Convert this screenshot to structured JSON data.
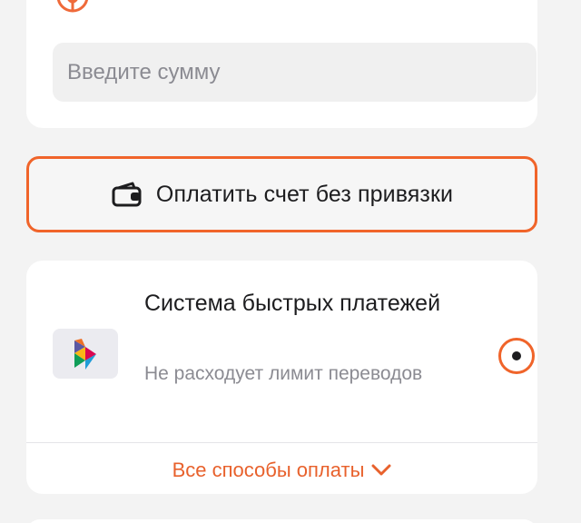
{
  "amount": {
    "placeholder": "Введите сумму",
    "value": ""
  },
  "pay_button": {
    "label": "Оплатить счет без привязки",
    "icon": "wallet-icon",
    "border_color": "#f0642a"
  },
  "payment_method": {
    "title": "Система быстрых платежей",
    "subtitle": "Не расходует лимит переводов",
    "icon": "sbp-logo",
    "selected": true
  },
  "all_methods": {
    "label": "Все способы оплаты",
    "icon": "chevron-down-icon",
    "color": "#e8612c"
  },
  "colors": {
    "accent": "#f0642a",
    "background": "#f3f3f3",
    "card": "#ffffff",
    "text": "#1d1d1f",
    "muted": "#8b8b92"
  }
}
